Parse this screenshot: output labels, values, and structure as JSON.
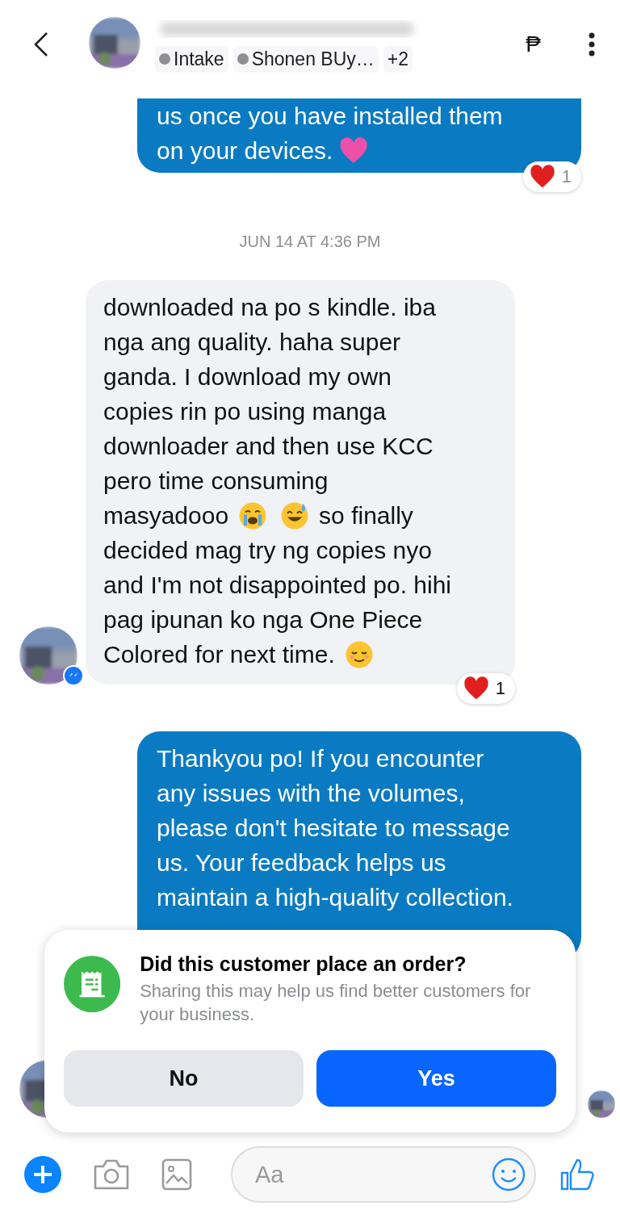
{
  "header": {
    "labels": [
      {
        "kind": "label",
        "text": "Intake"
      },
      {
        "kind": "label",
        "text": "Shonen BUy…"
      },
      {
        "kind": "more",
        "text": "+2"
      }
    ],
    "payment": "₱"
  },
  "messages": [
    {
      "kind": "sent",
      "lines": [
        [
          {
            "kind": "text",
            "text": "us once you have installed them"
          }
        ],
        [
          {
            "kind": "text",
            "text": "on your devices."
          },
          {
            "kind": "pinkheart"
          }
        ]
      ],
      "reaction": {
        "count": "1"
      }
    },
    {
      "kind": "timestamp",
      "text": "JUN 14 AT 4:36 PM"
    },
    {
      "kind": "received",
      "lines": [
        [
          {
            "kind": "text",
            "text": "downloaded na po s kindle. iba"
          }
        ],
        [
          {
            "kind": "text",
            "text": "nga ang quality. haha super"
          }
        ],
        [
          {
            "kind": "text",
            "text": "ganda. I download my own"
          }
        ],
        [
          {
            "kind": "text",
            "text": "copies rin po using manga"
          }
        ],
        [
          {
            "kind": "text",
            "text": "downloader and then use KCC"
          }
        ],
        [
          {
            "kind": "text",
            "text": "pero time consuming"
          }
        ],
        [
          {
            "kind": "text",
            "text": "masyadooo"
          },
          {
            "kind": "crying"
          },
          {
            "kind": "sweatsmile"
          },
          {
            "kind": "text",
            "text": "so finally"
          }
        ],
        [
          {
            "kind": "text",
            "text": "decided mag try ng copies nyo"
          }
        ],
        [
          {
            "kind": "text",
            "text": "and I'm not disappointed po. hihi"
          }
        ],
        [
          {
            "kind": "text",
            "text": "pag ipunan ko nga One Piece"
          }
        ],
        [
          {
            "kind": "text",
            "text": "Colored for next time."
          },
          {
            "kind": "relieved"
          }
        ]
      ],
      "reaction": {
        "count": "1"
      }
    },
    {
      "kind": "sent",
      "lines": [
        [
          {
            "kind": "text",
            "text": "Thankyou po! If you encounter"
          }
        ],
        [
          {
            "kind": "text",
            "text": "any issues with the volumes,"
          }
        ],
        [
          {
            "kind": "text",
            "text": "please don't hesitate to message"
          }
        ],
        [
          {
            "kind": "text",
            "text": "us. Your feedback helps us"
          }
        ],
        [
          {
            "kind": "text",
            "text": "maintain a high-quality collection."
          }
        ]
      ]
    }
  ],
  "prompt": {
    "title": "Did this customer place an order?",
    "subtitle": "Sharing this may help us find better customers for your business.",
    "buttons": [
      {
        "kind": "secondary",
        "label": "No"
      },
      {
        "kind": "primary",
        "label": "Yes"
      }
    ]
  },
  "composer": {
    "placeholder": "Aa"
  }
}
